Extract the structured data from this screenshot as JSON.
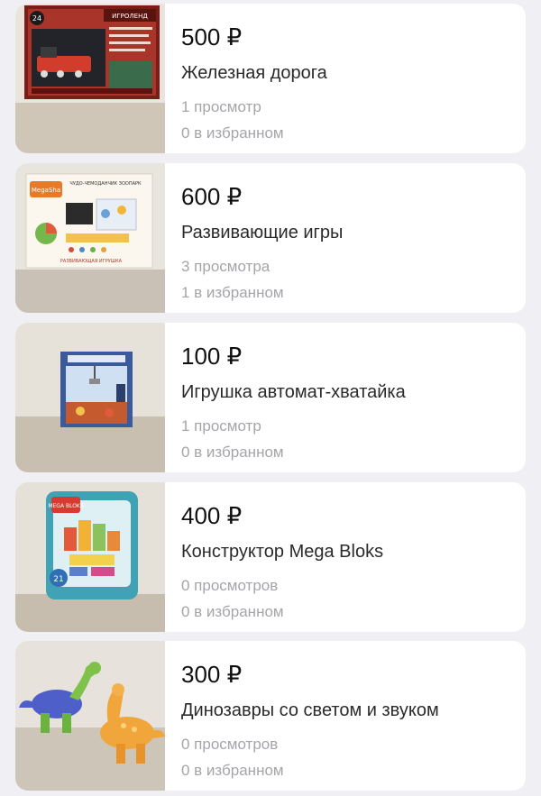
{
  "listings": [
    {
      "price": "500 ₽",
      "title": "Железная дорога",
      "views": "1 просмотр",
      "favorites": "0 в избранном",
      "image_icon": "toy-railway-box-photo",
      "box_label": "ИГРОЛЕНД",
      "box_badge": "24"
    },
    {
      "price": "600 ₽",
      "title": "Развивающие игры",
      "views": "3 просмотра",
      "favorites": "1 в избранном",
      "image_icon": "educational-game-box-photo",
      "box_brand": "MegaSha",
      "box_header": "ЧУДО-ЧЕМОДАНЧИК ЗООПАРК",
      "box_footer": "РАЗВИВАЮЩАЯ ИГРУШКА"
    },
    {
      "price": "100 ₽",
      "title": "Игрушка автомат-хватайка",
      "views": "1 просмотр",
      "favorites": "0 в избранном",
      "image_icon": "claw-machine-toy-photo"
    },
    {
      "price": "400 ₽",
      "title": "Конструктор Mega Bloks",
      "views": "0 просмотров",
      "favorites": "0 в избранном",
      "image_icon": "mega-bloks-bag-photo",
      "box_brand": "MEGA BLOKS",
      "box_count": "21"
    },
    {
      "price": "300 ₽",
      "title": "Динозавры со светом и звуком",
      "views": "0 просмотров",
      "favorites": "0 в избранном",
      "image_icon": "toy-dinosaurs-photo"
    }
  ],
  "colors": {
    "background": "#efeff4",
    "card": "#ffffff",
    "price": "#111111",
    "meta": "#a5a5a9"
  }
}
